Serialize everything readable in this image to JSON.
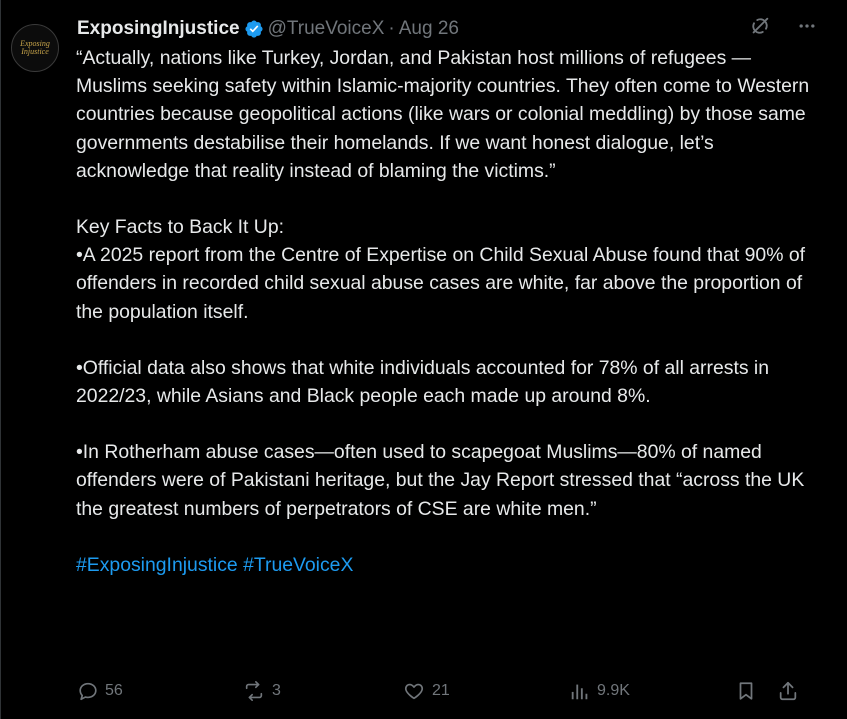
{
  "post": {
    "author": {
      "display_name": "ExposingInjustice",
      "handle": "@TrueVoiceX",
      "separator": "·",
      "date": "Aug 26",
      "verified": true,
      "avatar_text": "Exposing Injustice"
    },
    "top_icons": [
      "grok-icon",
      "more-icon"
    ],
    "paragraphs": [
      "“Actually, nations like Turkey, Jordan, and Pakistan host millions of refugees —Muslims seeking safety within Islamic-majority countries. They often come to Western countries because geopolitical actions (like wars or colonial meddling) by those same governments destabilise their homelands. If we want honest dialogue, let’s acknowledge that reality instead of blaming the victims.”",
      "Key Facts to Back It Up:",
      "•A 2025 report from the Centre of Expertise on Child Sexual Abuse found that 90% of offenders in recorded child sexual abuse cases are white, far above the proportion of the population itself.",
      "•Official data also shows that white individuals accounted for 78% of all arrests in 2022/23, while Asians and Black people each made up around 8%.",
      "•In Rotherham abuse cases—often used to scapegoat Muslims—80% of named offenders were of Pakistani heritage, but the Jay Report stressed that “across the UK the greatest numbers of perpetrators of CSE are white men.”"
    ],
    "hashtags": "#ExposingInjustice #TrueVoiceX",
    "stats": {
      "replies": "56",
      "reposts": "3",
      "likes": "21",
      "views": "9.9K"
    }
  },
  "colors": {
    "background": "#000000",
    "text": "#e7e9ea",
    "muted": "#71767b",
    "accent": "#1d9bf0"
  }
}
